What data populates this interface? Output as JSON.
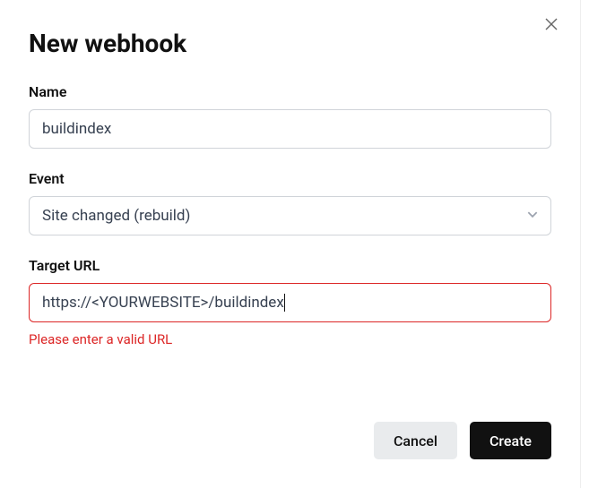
{
  "modal": {
    "title": "New webhook",
    "close_icon_name": "close-icon",
    "fields": {
      "name": {
        "label": "Name",
        "value": "buildindex"
      },
      "event": {
        "label": "Event",
        "selected": "Site changed (rebuild)"
      },
      "target_url": {
        "label": "Target URL",
        "value": "https://<YOURWEBSITE>/buildindex",
        "error": "Please enter a valid URL"
      }
    },
    "actions": {
      "cancel": "Cancel",
      "create": "Create"
    }
  }
}
